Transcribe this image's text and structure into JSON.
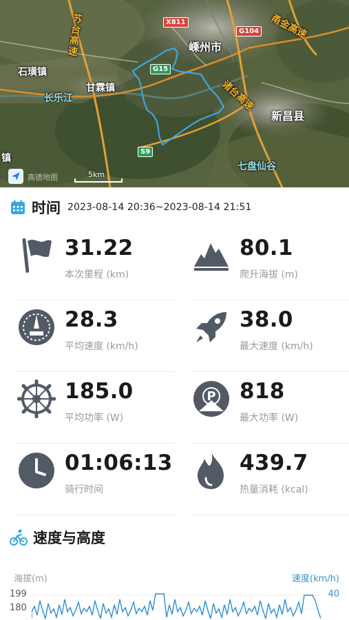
{
  "map": {
    "labels": {
      "shengzhou": "嵊州市",
      "xinchang": "新昌县",
      "ganlin": "甘霖镇",
      "shihuang": "石璜镇",
      "changle_river": "长乐江",
      "qipan": "七盘仙谷",
      "zhen": "镇",
      "jiang": "江"
    },
    "roads": {
      "sutai": "苏台高速",
      "yongjin": "甬金高速",
      "zhutai": "诸台高速",
      "g104": "G104",
      "x811": "X811",
      "g15": "G15",
      "s9": "S9"
    },
    "scale": "5km",
    "logo_text": "高德地图"
  },
  "time": {
    "title": "时间",
    "range": "2023-08-14 20:36~2023-08-14 21:51"
  },
  "stats": [
    {
      "value": "31.22",
      "label": "本次里程 (km)"
    },
    {
      "value": "80.1",
      "label": "爬升海拔 (m)"
    },
    {
      "value": "28.3",
      "label": "平均速度 (km/h)"
    },
    {
      "value": "38.0",
      "label": "最大速度 (km/h)"
    },
    {
      "value": "185.0",
      "label": "平均功率 (W)"
    },
    {
      "value": "818",
      "label": "最大功率 (W)"
    },
    {
      "value": "01:06:13",
      "label": "骑行时间"
    },
    {
      "value": "439.7",
      "label": "热量消耗 (kcal)"
    }
  ],
  "speed_altitude": {
    "title": "速度与高度",
    "left_axis_title": "海拔(m)",
    "right_axis_title": "速度(km/h)",
    "left_ticks": [
      "199",
      "180"
    ],
    "right_ticks": [
      "40"
    ]
  },
  "colors": {
    "route": "#3fa6e0",
    "icon": "#525a66",
    "speed": "#2f8fcf",
    "divider": "#e9e9e9"
  }
}
